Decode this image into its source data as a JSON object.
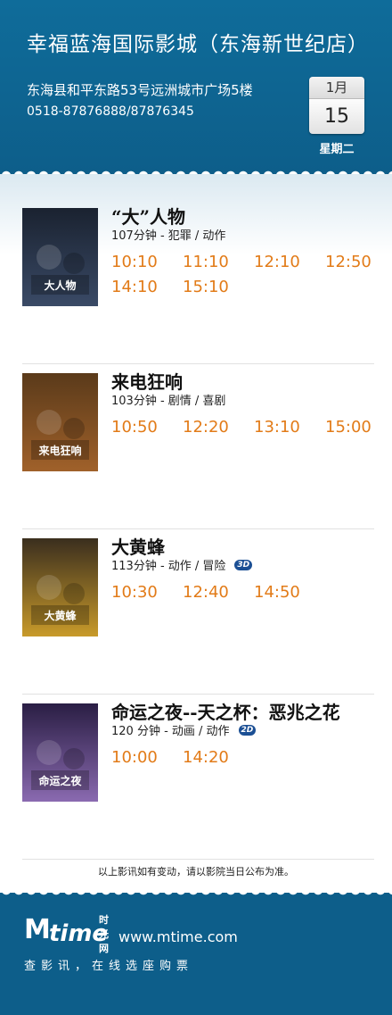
{
  "header": {
    "cinema_name": "幸福蓝海国际影城（东海新世纪店）",
    "address": "东海县和平东路53号远洲城市广场5楼",
    "phone": "0518-87876888/87876345",
    "month": "1月",
    "day": "15",
    "weekday": "星期二"
  },
  "movies": [
    {
      "title": "“大”人物",
      "meta": "107分钟 - 犯罪 / 动作",
      "badge": "",
      "showtimes": [
        "10:10",
        "11:10",
        "12:10",
        "12:50",
        "14:10",
        "15:10"
      ],
      "poster": {
        "icon": "poster-da-renwu",
        "colors": [
          "#1a2230",
          "#3a4a66"
        ],
        "text": "大人物"
      }
    },
    {
      "title": "来电狂响",
      "meta": "103分钟 - 剧情 / 喜剧",
      "badge": "",
      "showtimes": [
        "10:50",
        "12:20",
        "13:10",
        "15:00"
      ],
      "poster": {
        "icon": "poster-laidian-kuangxiang",
        "colors": [
          "#5a3a1a",
          "#a0612a"
        ],
        "text": "来电狂响"
      }
    },
    {
      "title": "大黄蜂",
      "meta": "113分钟 - 动作 / 冒险",
      "badge": "3D",
      "showtimes": [
        "10:30",
        "12:40",
        "14:50"
      ],
      "poster": {
        "icon": "poster-bumblebee",
        "colors": [
          "#3a2e1e",
          "#c89a2a"
        ],
        "text": "大黄蜂"
      }
    },
    {
      "title": "命运之夜--天之杯：恶兆之花",
      "meta": "120 分钟 - 动画 / 动作",
      "badge": "2D",
      "showtimes": [
        "10:00",
        "14:20"
      ],
      "poster": {
        "icon": "poster-fate-heavens-feel",
        "colors": [
          "#2a1e44",
          "#8a6ab0"
        ],
        "text": "命运之夜"
      }
    }
  ],
  "notice": "以上影讯如有变动，请以影院当日公布为准。",
  "footer": {
    "logo_m": "M",
    "logo_time": "time",
    "logo_cn": "时光网",
    "site": "www.mtime.com",
    "slogan": "查影讯，在线选座购票"
  },
  "colors": {
    "header_bg": "#0d5e8a",
    "showtime": "#e27b18",
    "badge": "#1b4f94"
  }
}
